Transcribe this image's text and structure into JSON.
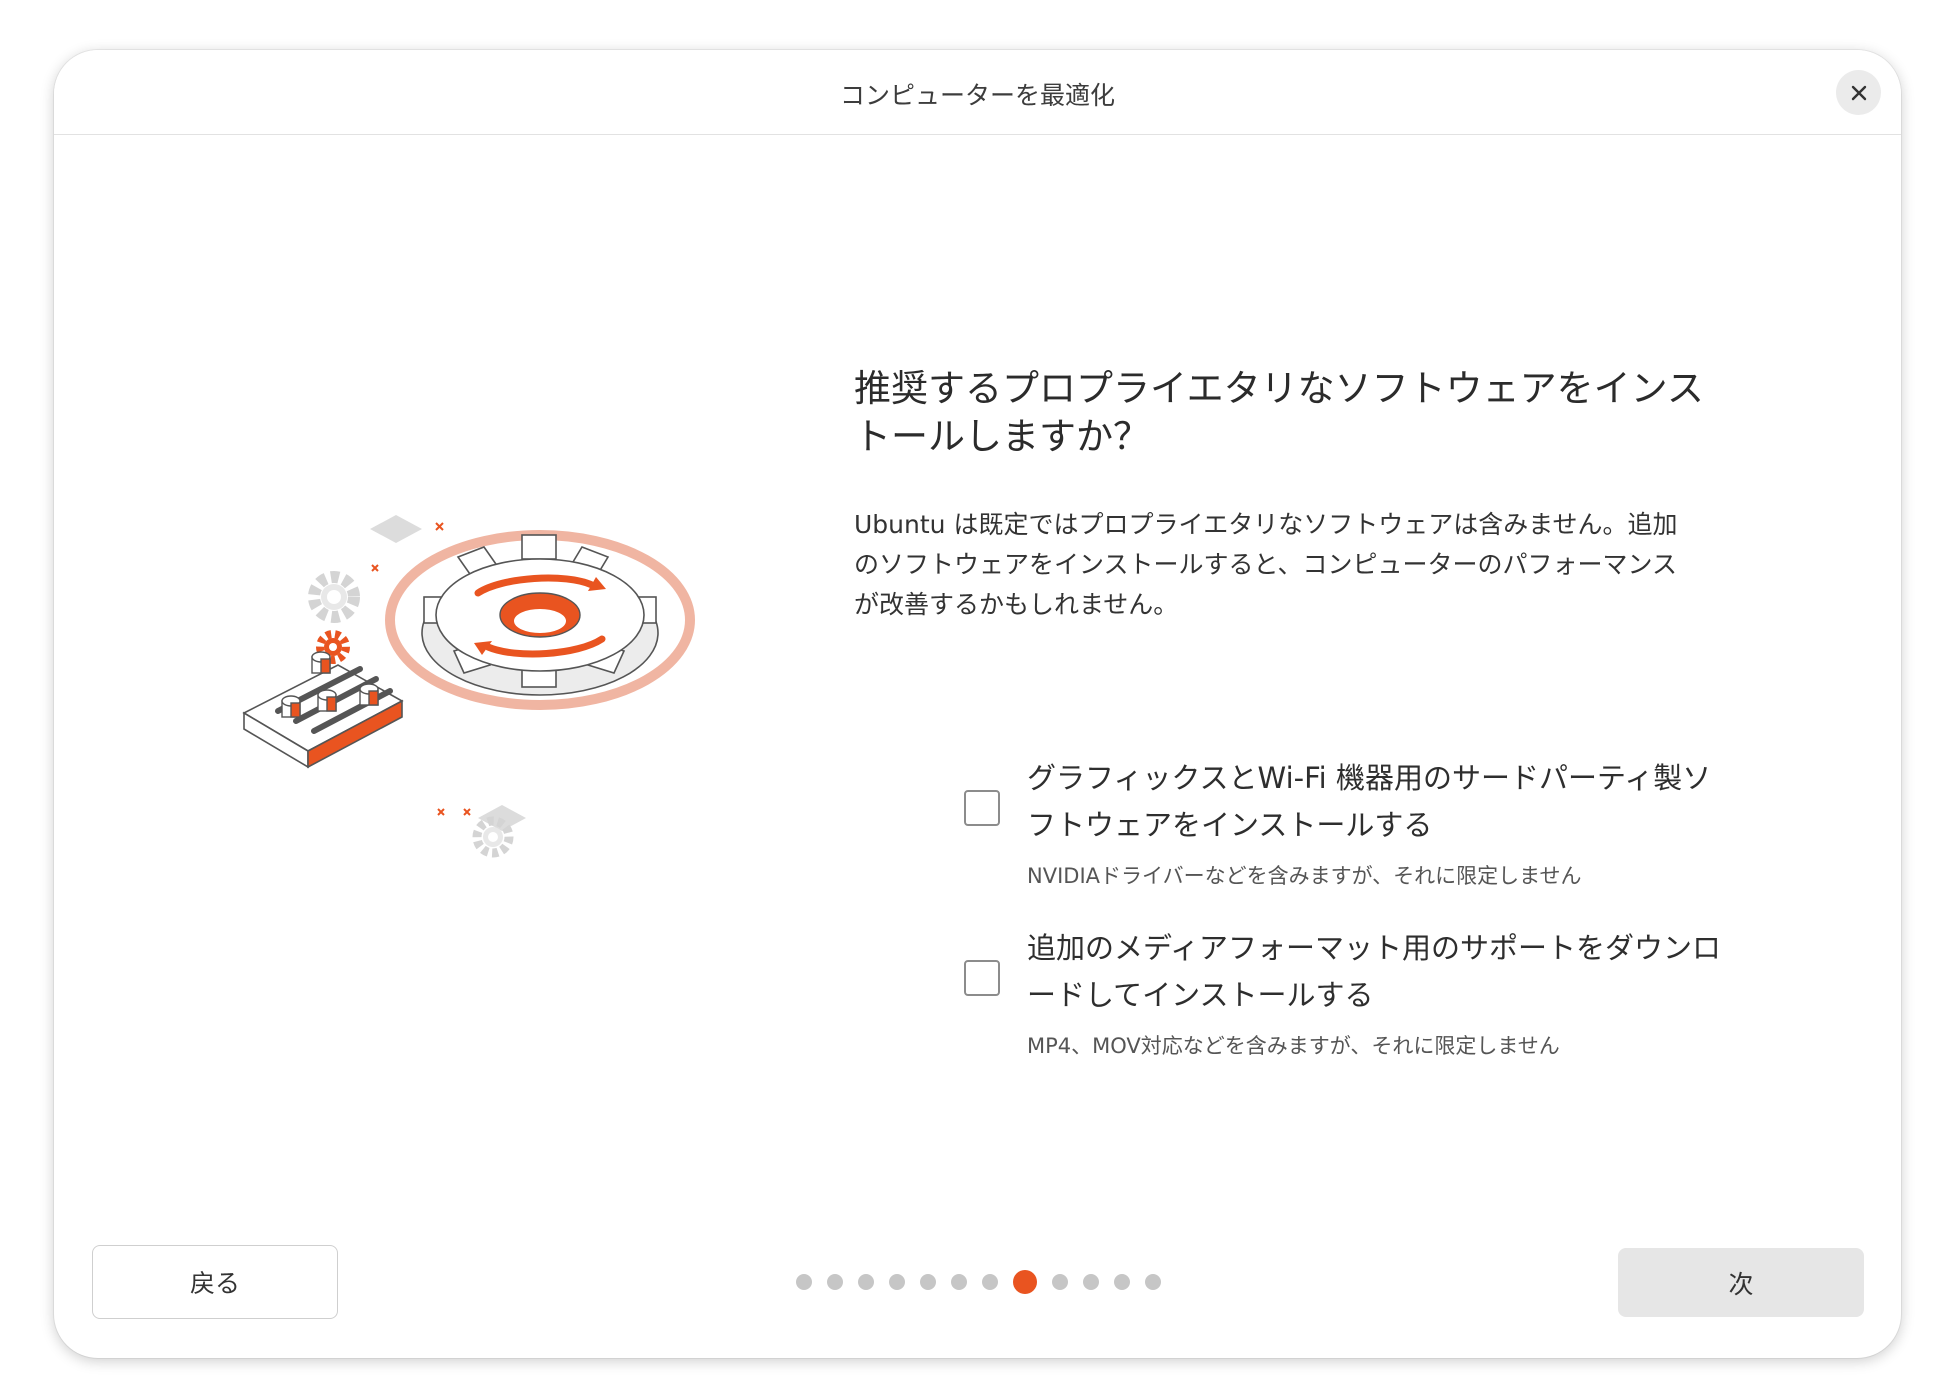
{
  "window": {
    "title": "コンピューターを最適化",
    "close_icon": "close-icon"
  },
  "main": {
    "heading": "推奨するプロプライエタリなソフトウェアをインストールしますか？",
    "description": "Ubuntu は既定ではプロプライエタリなソフトウェアは含みません。追加のソフトウェアをインストールすると、コンピューターのパフォーマンスが改善するかもしれません。",
    "options": [
      {
        "label": "グラフィックスとWi-Fi 機器用のサードパーティ製ソフトウェアをインストールする",
        "sublabel": "NVIDIAドライバーなどを含みますが、それに限定しません",
        "checked": false
      },
      {
        "label": "追加のメディアフォーマット用のサポートをダウンロードしてインストールする",
        "sublabel": "MP4、MOV対応などを含みますが、それに限定しません",
        "checked": false
      }
    ]
  },
  "footer": {
    "back_label": "戻る",
    "next_label": "次",
    "progress": {
      "total_steps": 12,
      "current_step": 8
    }
  },
  "colors": {
    "accent": "#e95420",
    "dot_inactive": "#c6c6c6",
    "next_button_bg": "#e6e6e6"
  }
}
